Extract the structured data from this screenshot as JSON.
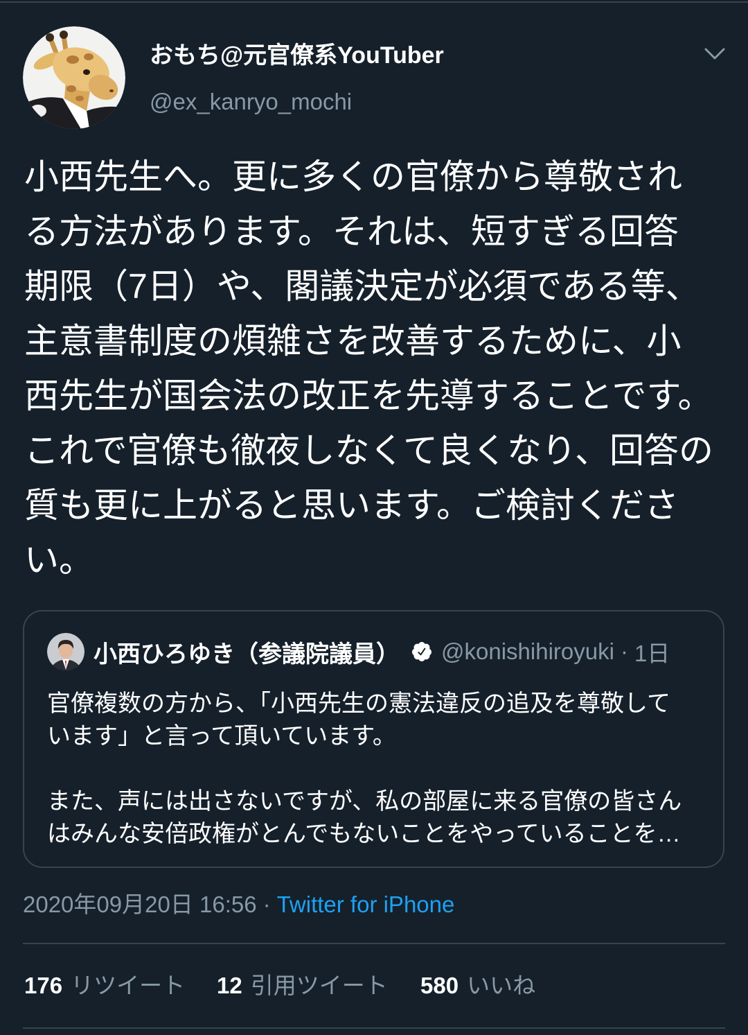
{
  "colors": {
    "background": "#15202B",
    "text_primary": "#FFFFFF",
    "text_secondary": "#8899A6",
    "accent": "#1DA1F2",
    "border": "#38444D"
  },
  "tweet": {
    "author": {
      "avatar_icon": "giraffe-avatar-icon",
      "display_name": "おもち@元官僚系YouTuber",
      "handle": "@ex_kanryo_mochi"
    },
    "menu_icon": "chevron-down-icon",
    "text_lines": [
      "小西先生へ。更に多くの官僚から尊敬され",
      "る方法があります。それは、短すぎる回答",
      "期限（7日）や、閣議決定が必須である等、",
      "主意書制度の煩雑さを改善するために、小",
      "西先生が国会法の改正を先導することです。",
      "これで官僚も徹夜しなくて良くなり、回答の",
      "質も更に上がると思います。ご検討くださ",
      "い。"
    ],
    "quoted_tweet": {
      "author": {
        "avatar_icon": "portrait-avatar-icon",
        "display_name": "小西ひろゆき（参議院議員）",
        "verified_icon": "verified-badge-icon",
        "handle": "@konishihiroyuki",
        "separator": "·",
        "time_ago": "1日"
      },
      "paragraphs": [
        [
          "官僚複数の方から、「小西先生の憲法違反の追及を尊敬して",
          "います」と言って頂いています。"
        ],
        [
          "また、声には出さないですが、私の部屋に来る官僚の皆さん",
          "はみんな安倍政権がとんでもないことをやっていることを…"
        ]
      ]
    },
    "timestamp": "2020年09月20日 16:56",
    "separator": "·",
    "source": "Twitter for iPhone",
    "stats": [
      {
        "count": "176",
        "label": "リツイート"
      },
      {
        "count": "12",
        "label": "引用ツイート"
      },
      {
        "count": "580",
        "label": "いいね"
      }
    ]
  }
}
